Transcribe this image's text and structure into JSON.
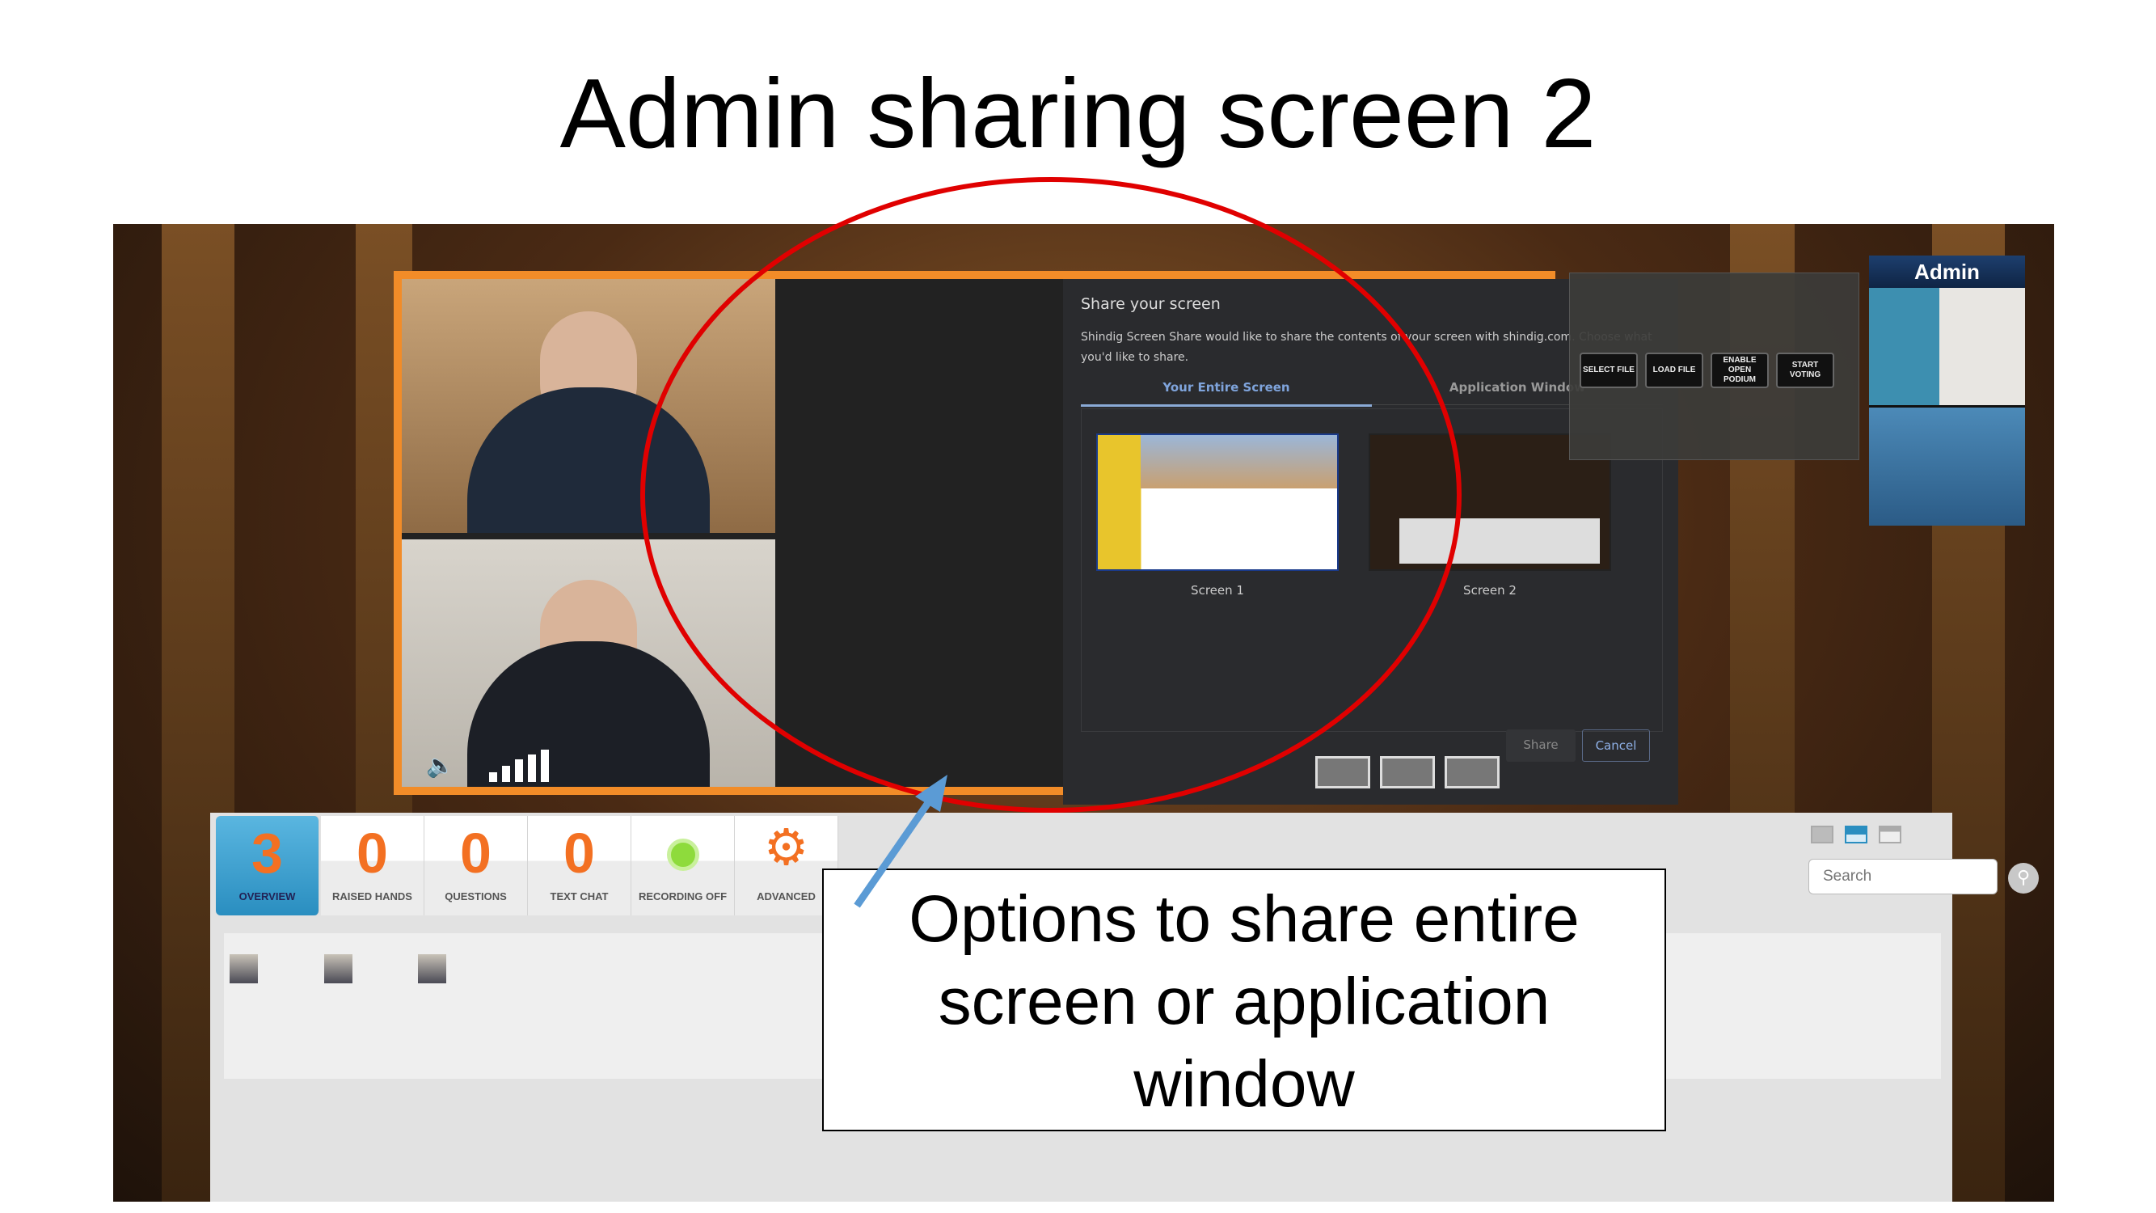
{
  "slide_title": "Admin sharing screen 2",
  "dialog": {
    "title": "Share your screen",
    "description": "Shindig Screen Share would like to share the contents of your screen with shindig.com. Choose what you'd like to share.",
    "tabs": [
      {
        "label": "Your Entire Screen",
        "active": true
      },
      {
        "label": "Application Window",
        "active": false
      }
    ],
    "screens": [
      {
        "label": "Screen 1"
      },
      {
        "label": "Screen 2"
      }
    ],
    "share_label": "Share",
    "cancel_label": "Cancel"
  },
  "control_buttons": [
    "SELECT FILE",
    "LOAD FILE",
    "ENABLE OPEN PODIUM",
    "START VOTING"
  ],
  "admin_label": "Admin",
  "status_tabs": [
    {
      "value": "3",
      "label": "OVERVIEW",
      "active": true
    },
    {
      "value": "0",
      "label": "RAISED HANDS"
    },
    {
      "value": "0",
      "label": "QUESTIONS"
    },
    {
      "value": "0",
      "label": "TEXT CHAT"
    },
    {
      "value": "",
      "label": "RECORDING OFF",
      "icon": "record-icon"
    },
    {
      "value": "",
      "label": "ADVANCED",
      "icon": "gear-icon"
    }
  ],
  "search": {
    "placeholder": "Search"
  },
  "callout": "Options to share entire screen or application window",
  "colors": {
    "frame": "#f28c28",
    "accent_number": "#f37022",
    "annotation_ellipse": "#e00000",
    "annotation_arrow": "#5b9bd5",
    "active_tab": "#2a8ec0",
    "recording": "#8edb3c"
  }
}
